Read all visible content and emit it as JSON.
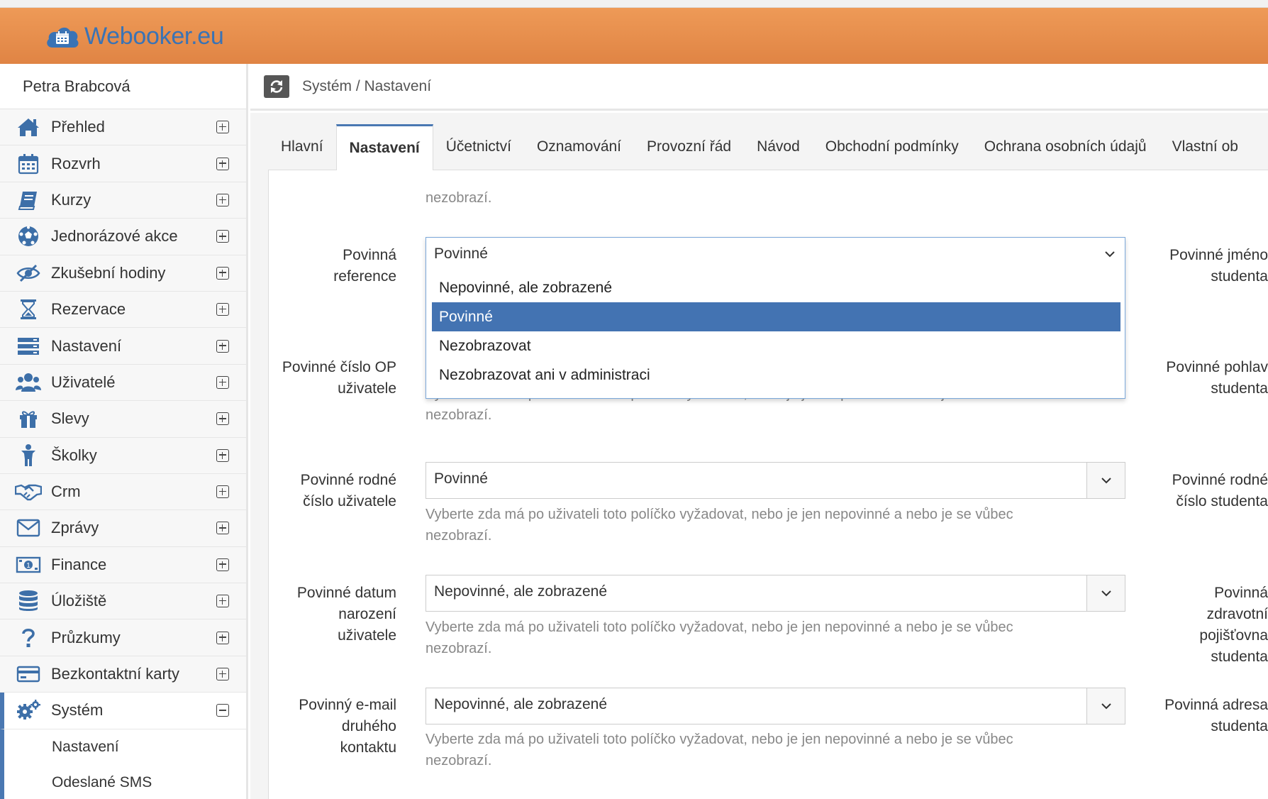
{
  "app": {
    "logo_text": "Webooker.eu",
    "accent": "#4a78b2",
    "header_color": "#e58c4a"
  },
  "user": {
    "name": "Petra Brabcová"
  },
  "sidebar": {
    "items": [
      {
        "label": "Přehled",
        "icon": "home-icon"
      },
      {
        "label": "Rozvrh",
        "icon": "calendar-icon"
      },
      {
        "label": "Kurzy",
        "icon": "book-icon"
      },
      {
        "label": "Jednorázové akce",
        "icon": "soccer-ball-icon"
      },
      {
        "label": "Zkušební hodiny",
        "icon": "eye-slash-icon"
      },
      {
        "label": "Rezervace",
        "icon": "hourglass-icon"
      },
      {
        "label": "Nastavení",
        "icon": "server-icon"
      },
      {
        "label": "Uživatelé",
        "icon": "users-icon"
      },
      {
        "label": "Slevy",
        "icon": "gift-icon"
      },
      {
        "label": "Školky",
        "icon": "child-icon"
      },
      {
        "label": "Crm",
        "icon": "handshake-icon"
      },
      {
        "label": "Zprávy",
        "icon": "envelope-icon"
      },
      {
        "label": "Finance",
        "icon": "money-icon"
      },
      {
        "label": "Úložiště",
        "icon": "database-icon"
      },
      {
        "label": "Průzkumy",
        "icon": "question-icon"
      },
      {
        "label": "Bezkontaktní karty",
        "icon": "credit-card-icon"
      },
      {
        "label": "Systém",
        "icon": "cogs-icon"
      }
    ],
    "sub_items": [
      "Nastavení",
      "Odeslané SMS"
    ]
  },
  "breadcrumb": {
    "text": "Systém / Nastavení"
  },
  "tabs": [
    "Hlavní",
    "Nastavení",
    "Účetnictví",
    "Oznamování",
    "Provozní řád",
    "Návod",
    "Obchodní podmínky",
    "Ochrana osobních údajů",
    "Vlastní ob"
  ],
  "form": {
    "top_help_fragment": "nezobrazí.",
    "help_line1": "Vyberte zda má po uživateli toto políčko vyžadovat, nebo je jen nepovinné a nebo je se vůbec",
    "help_line2": "nezobrazí.",
    "fields": [
      {
        "label_l1": "Povinná",
        "label_l2": "reference",
        "value": "Povinné"
      },
      {
        "label_l1": "Povinné číslo OP",
        "label_l2": "uživatele",
        "value": ""
      },
      {
        "label_l1": "Povinné rodné",
        "label_l2": "číslo uživatele",
        "value": "Povinné"
      },
      {
        "label_l1": "Povinné datum",
        "label_l2": "narození",
        "label_l3": "uživatele",
        "value": "Nepovinné, ale zobrazené"
      },
      {
        "label_l1": "Povinný e-mail",
        "label_l2": "druhého",
        "label_l3": "kontaktu",
        "value": "Nepovinné, ale zobrazené"
      }
    ],
    "right_labels": [
      {
        "l1": "Povinné jméno",
        "l2": "studenta"
      },
      {
        "l1": "Povinné pohlav",
        "l2": "studenta"
      },
      {
        "l1": "Povinné rodné",
        "l2": "číslo studenta"
      },
      {
        "l1": "Povinná",
        "l2": "zdravotní",
        "l3": "pojišťovna",
        "l4": "studenta"
      },
      {
        "l1": "Povinná adresa",
        "l2": "studenta"
      }
    ]
  },
  "dropdown": {
    "options": [
      "Nepovinné, ale zobrazené",
      "Povinné",
      "Nezobrazovat",
      "Nezobrazovat ani v administraci"
    ],
    "selected": "Povinné"
  }
}
